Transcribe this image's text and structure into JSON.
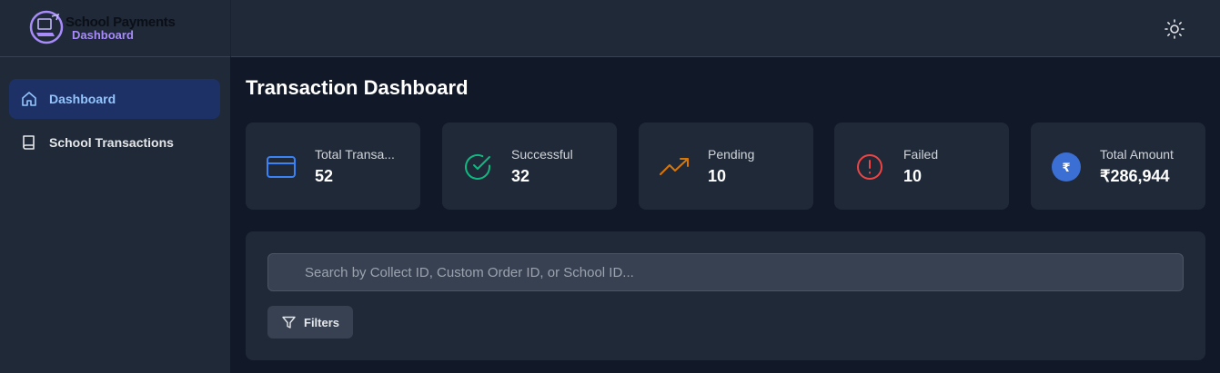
{
  "brand": {
    "title": "School Payments",
    "subtitle": "Dashboard"
  },
  "header": {
    "theme_toggle_icon": "sun-icon"
  },
  "sidebar": {
    "items": [
      {
        "label": "Dashboard",
        "icon": "home-icon",
        "active": true
      },
      {
        "label": "School Transactions",
        "icon": "book-icon",
        "active": false
      }
    ]
  },
  "main": {
    "title": "Transaction Dashboard",
    "stats": [
      {
        "label": "Total Transa...",
        "value": "52",
        "icon": "credit-card-icon",
        "color": "#3b82f6"
      },
      {
        "label": "Successful",
        "value": "32",
        "icon": "check-circle-icon",
        "color": "#10b981"
      },
      {
        "label": "Pending",
        "value": "10",
        "icon": "trending-up-icon",
        "color": "#d97706"
      },
      {
        "label": "Failed",
        "value": "10",
        "icon": "alert-circle-icon",
        "color": "#ef4444"
      },
      {
        "label": "Total Amount",
        "value": "₹286,944",
        "icon": "rupee-icon",
        "color": "#3b6fd4"
      }
    ],
    "search": {
      "placeholder": "Search by Collect ID, Custom Order ID, or School ID...",
      "value": ""
    },
    "filters_button": "Filters"
  }
}
